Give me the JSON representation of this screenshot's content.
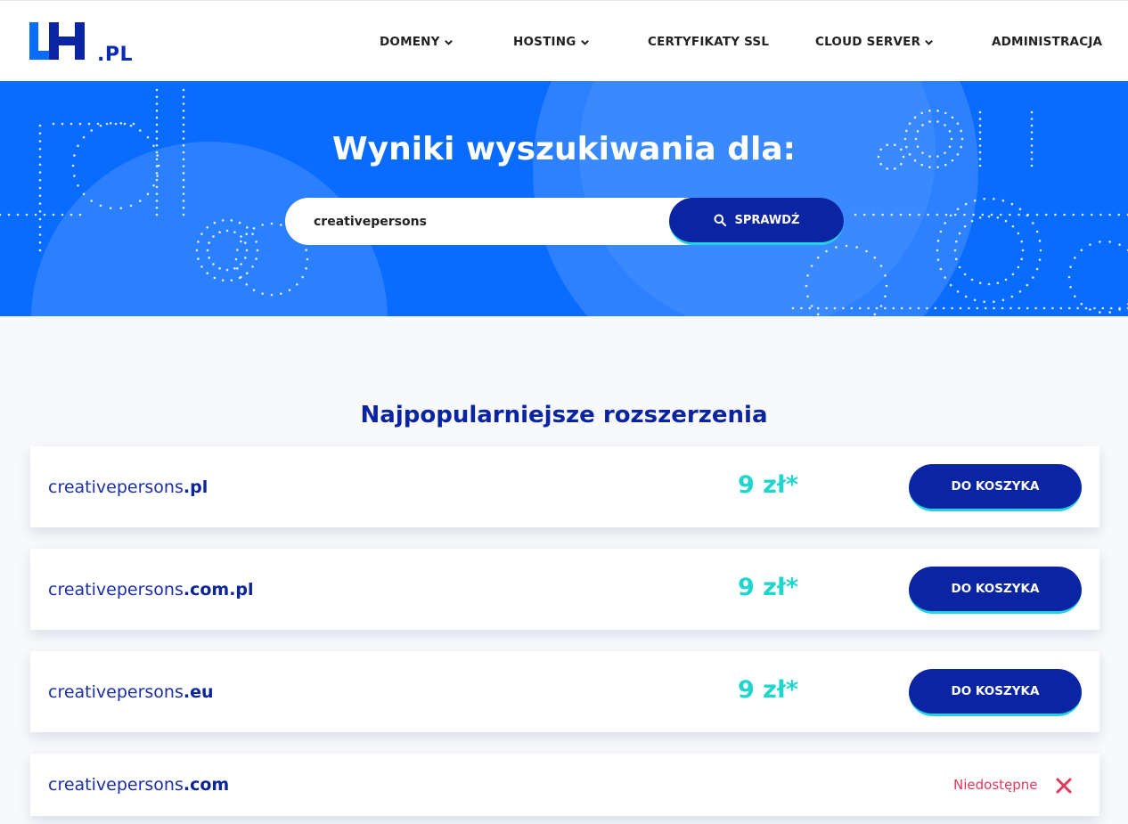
{
  "brand": {
    "logo_text": ".PL",
    "logo_letters": "LH"
  },
  "nav": [
    {
      "label": "DOMENY",
      "has_dropdown": true
    },
    {
      "label": "HOSTING",
      "has_dropdown": true
    },
    {
      "label": "CERTYFIKATY SSL",
      "has_dropdown": false
    },
    {
      "label": "CLOUD SERVER",
      "has_dropdown": true
    },
    {
      "label": "ADMINISTRACJA",
      "has_dropdown": false
    }
  ],
  "hero": {
    "title": "Wyniki wyszukiwania dla:",
    "search_value": "creativepersons",
    "search_button": "SPRAWDŹ"
  },
  "results": {
    "title": "Najpopularniejsze rozszerzenia",
    "rows": [
      {
        "name": "creativepersons",
        "tld": ".pl",
        "price": "9 zł*",
        "button": "DO KOSZYKA",
        "available": true
      },
      {
        "name": "creativepersons",
        "tld": ".com.pl",
        "price": "9 zł*",
        "button": "DO KOSZYKA",
        "available": true
      },
      {
        "name": "creativepersons",
        "tld": ".eu",
        "price": "9 zł*",
        "button": "DO KOSZYKA",
        "available": true
      },
      {
        "name": "creativepersons",
        "tld": ".com",
        "status": "Niedostępne",
        "available": false
      }
    ]
  },
  "colors": {
    "hero_bg": "#0a6bff",
    "primary_dark": "#0a24a3",
    "accent_cyan": "#1fd3e0",
    "price_color": "#1fd6cf",
    "unavailable": "#e0395b"
  },
  "icons": {
    "search": "search-icon",
    "dropdown": "chevron-down-icon",
    "unavailable": "close-icon"
  }
}
